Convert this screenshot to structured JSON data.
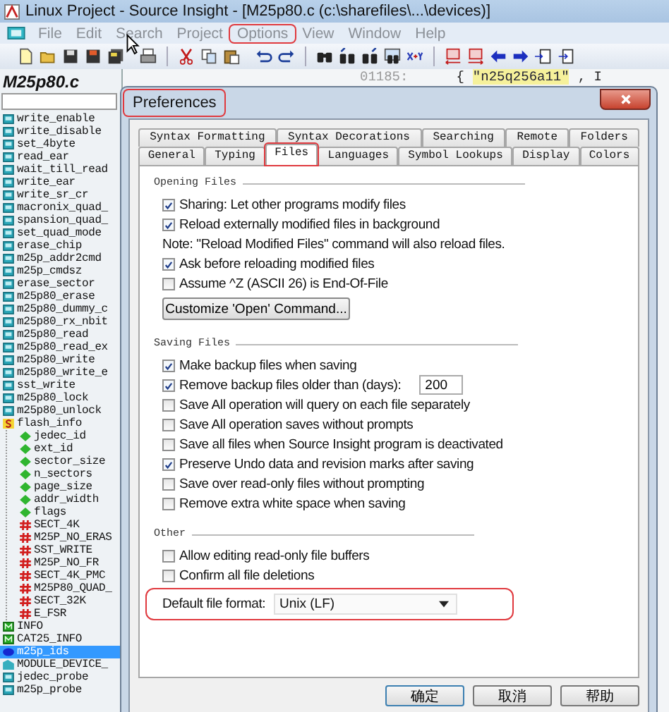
{
  "window": {
    "title": "Linux Project - Source Insight - [M25p80.c (c:\\sharefiles\\...\\devices)]"
  },
  "menu": [
    {
      "label": "File",
      "highlighted": false
    },
    {
      "label": "Edit",
      "highlighted": false
    },
    {
      "label": "Search",
      "highlighted": false
    },
    {
      "label": "Project",
      "highlighted": false
    },
    {
      "label": "Options",
      "highlighted": true
    },
    {
      "label": "View",
      "highlighted": false
    },
    {
      "label": "Window",
      "highlighted": false
    },
    {
      "label": "Help",
      "highlighted": false
    }
  ],
  "symbol_panel": {
    "title": "M25p80.c",
    "symbols": [
      {
        "name": "write_enable",
        "kind": "function",
        "selected": false
      },
      {
        "name": "write_disable",
        "kind": "function",
        "selected": false
      },
      {
        "name": "set_4byte",
        "kind": "function",
        "selected": false
      },
      {
        "name": "read_ear",
        "kind": "function",
        "selected": false
      },
      {
        "name": "wait_till_read",
        "kind": "function",
        "selected": false
      },
      {
        "name": "write_ear",
        "kind": "function",
        "selected": false
      },
      {
        "name": "write_sr_cr",
        "kind": "function",
        "selected": false
      },
      {
        "name": "macronix_quad_",
        "kind": "function",
        "selected": false
      },
      {
        "name": "spansion_quad_",
        "kind": "function",
        "selected": false
      },
      {
        "name": "set_quad_mode",
        "kind": "function",
        "selected": false
      },
      {
        "name": "erase_chip",
        "kind": "function",
        "selected": false
      },
      {
        "name": "m25p_addr2cmd",
        "kind": "function",
        "selected": false
      },
      {
        "name": "m25p_cmdsz",
        "kind": "function",
        "selected": false
      },
      {
        "name": "erase_sector",
        "kind": "function",
        "selected": false
      },
      {
        "name": "m25p80_erase",
        "kind": "function",
        "selected": false
      },
      {
        "name": "m25p80_dummy_c",
        "kind": "function",
        "selected": false
      },
      {
        "name": "m25p80_rx_nbit",
        "kind": "function",
        "selected": false
      },
      {
        "name": "m25p80_read",
        "kind": "function",
        "selected": false
      },
      {
        "name": "m25p80_read_ex",
        "kind": "function",
        "selected": false
      },
      {
        "name": "m25p80_write",
        "kind": "function",
        "selected": false
      },
      {
        "name": "m25p80_write_e",
        "kind": "function",
        "selected": false
      },
      {
        "name": "sst_write",
        "kind": "function",
        "selected": false
      },
      {
        "name": "m25p80_lock",
        "kind": "function",
        "selected": false
      },
      {
        "name": "m25p80_unlock",
        "kind": "function",
        "selected": false
      },
      {
        "name": "flash_info",
        "kind": "struct",
        "selected": false,
        "children": [
          {
            "name": "jedec_id",
            "kind": "member",
            "selected": false
          },
          {
            "name": "ext_id",
            "kind": "member",
            "selected": false
          },
          {
            "name": "sector_size",
            "kind": "member",
            "selected": false
          },
          {
            "name": "n_sectors",
            "kind": "member",
            "selected": false
          },
          {
            "name": "page_size",
            "kind": "member",
            "selected": false
          },
          {
            "name": "addr_width",
            "kind": "member",
            "selected": false
          },
          {
            "name": "flags",
            "kind": "member",
            "selected": false
          },
          {
            "name": "SECT_4K",
            "kind": "macro",
            "selected": false
          },
          {
            "name": "M25P_NO_ERAS",
            "kind": "macro",
            "selected": false
          },
          {
            "name": "SST_WRITE",
            "kind": "macro",
            "selected": false
          },
          {
            "name": "M25P_NO_FR",
            "kind": "macro",
            "selected": false
          },
          {
            "name": "SECT_4K_PMC",
            "kind": "macro",
            "selected": false
          },
          {
            "name": "M25P80_QUAD_",
            "kind": "macro",
            "selected": false
          },
          {
            "name": "SECT_32K",
            "kind": "macro",
            "selected": false
          },
          {
            "name": "E_FSR",
            "kind": "macro",
            "selected": false
          }
        ]
      },
      {
        "name": "INFO",
        "kind": "constant",
        "selected": false
      },
      {
        "name": "CAT25_INFO",
        "kind": "constant",
        "selected": false
      },
      {
        "name": "m25p_ids",
        "kind": "variable",
        "selected": true
      },
      {
        "name": "MODULE_DEVICE_",
        "kind": "declaration",
        "selected": false
      },
      {
        "name": "jedec_probe",
        "kind": "function",
        "selected": false
      },
      {
        "name": "m25p_probe",
        "kind": "function",
        "selected": false
      }
    ]
  },
  "editor": {
    "lines": [
      {
        "number": "01185:",
        "code": "{",
        "string": "\"n25q256a11\"",
        "rest": ",  I"
      }
    ]
  },
  "dialog": {
    "title": "Preferences",
    "title_highlighted": true,
    "tab_rows": [
      [
        {
          "label": "Syntax Formatting",
          "selected": false,
          "highlighted": false
        },
        {
          "label": "Syntax Decorations",
          "selected": false,
          "highlighted": false
        },
        {
          "label": "Searching",
          "selected": false,
          "highlighted": false
        },
        {
          "label": "Remote",
          "selected": false,
          "highlighted": false
        },
        {
          "label": "Folders",
          "selected": false,
          "highlighted": false
        }
      ],
      [
        {
          "label": "General",
          "selected": false,
          "highlighted": false
        },
        {
          "label": "Typing",
          "selected": false,
          "highlighted": false
        },
        {
          "label": "Files",
          "selected": true,
          "highlighted": true
        },
        {
          "label": "Languages",
          "selected": false,
          "highlighted": false
        },
        {
          "label": "Symbol Lookups",
          "selected": false,
          "highlighted": false
        },
        {
          "label": "Display",
          "selected": false,
          "highlighted": false
        },
        {
          "label": "Colors",
          "selected": false,
          "highlighted": false
        }
      ]
    ],
    "sections": [
      {
        "title": "Opening Files",
        "items": [
          {
            "kind": "checkbox",
            "label": "Sharing: Let other programs modify files",
            "checked": true,
            "highlighted": false
          },
          {
            "kind": "checkbox",
            "label": "Reload externally modified files in background",
            "checked": true,
            "highlighted": false
          },
          {
            "kind": "note",
            "text": "Note: \"Reload Modified Files\" command will also reload files.",
            "highlighted": false
          },
          {
            "kind": "checkbox",
            "label": "Ask before reloading modified files",
            "checked": true,
            "highlighted": false
          },
          {
            "kind": "checkbox",
            "label": "Assume ^Z (ASCII 26) is End-Of-File",
            "checked": false,
            "highlighted": false
          },
          {
            "kind": "button",
            "label": "Customize 'Open' Command...",
            "highlighted": false
          }
        ]
      },
      {
        "title": "Saving Files",
        "items": [
          {
            "kind": "checkbox",
            "label": "Make backup files when saving",
            "checked": true,
            "highlighted": false
          },
          {
            "kind": "checkbox_number",
            "label": "Remove backup files older than (days):",
            "checked": true,
            "value": "200",
            "highlighted": false
          },
          {
            "kind": "checkbox",
            "label": "Save All operation will query on each file separately",
            "checked": false,
            "highlighted": false
          },
          {
            "kind": "checkbox",
            "label": "Save All operation saves without prompts",
            "checked": false,
            "highlighted": false
          },
          {
            "kind": "checkbox",
            "label": "Save all files when Source Insight program is deactivated",
            "checked": false,
            "highlighted": false
          },
          {
            "kind": "checkbox",
            "label": "Preserve Undo data and revision marks after saving",
            "checked": true,
            "highlighted": false
          },
          {
            "kind": "checkbox",
            "label": "Save over read-only files without prompting",
            "checked": false,
            "highlighted": false
          },
          {
            "kind": "checkbox",
            "label": "Remove extra white space when saving",
            "checked": false,
            "highlighted": false
          }
        ]
      },
      {
        "title": "Other",
        "items": [
          {
            "kind": "checkbox",
            "label": "Allow editing read-only file buffers",
            "checked": false,
            "highlighted": false
          },
          {
            "kind": "checkbox",
            "label": "Confirm all file deletions",
            "checked": false,
            "highlighted": false
          },
          {
            "kind": "select",
            "label": "Default file format:",
            "value": "Unix (LF)",
            "highlighted": true
          }
        ]
      }
    ],
    "buttons": [
      {
        "label": "确定",
        "default": true
      },
      {
        "label": "取消",
        "default": false
      },
      {
        "label": "帮助",
        "default": false
      }
    ]
  }
}
